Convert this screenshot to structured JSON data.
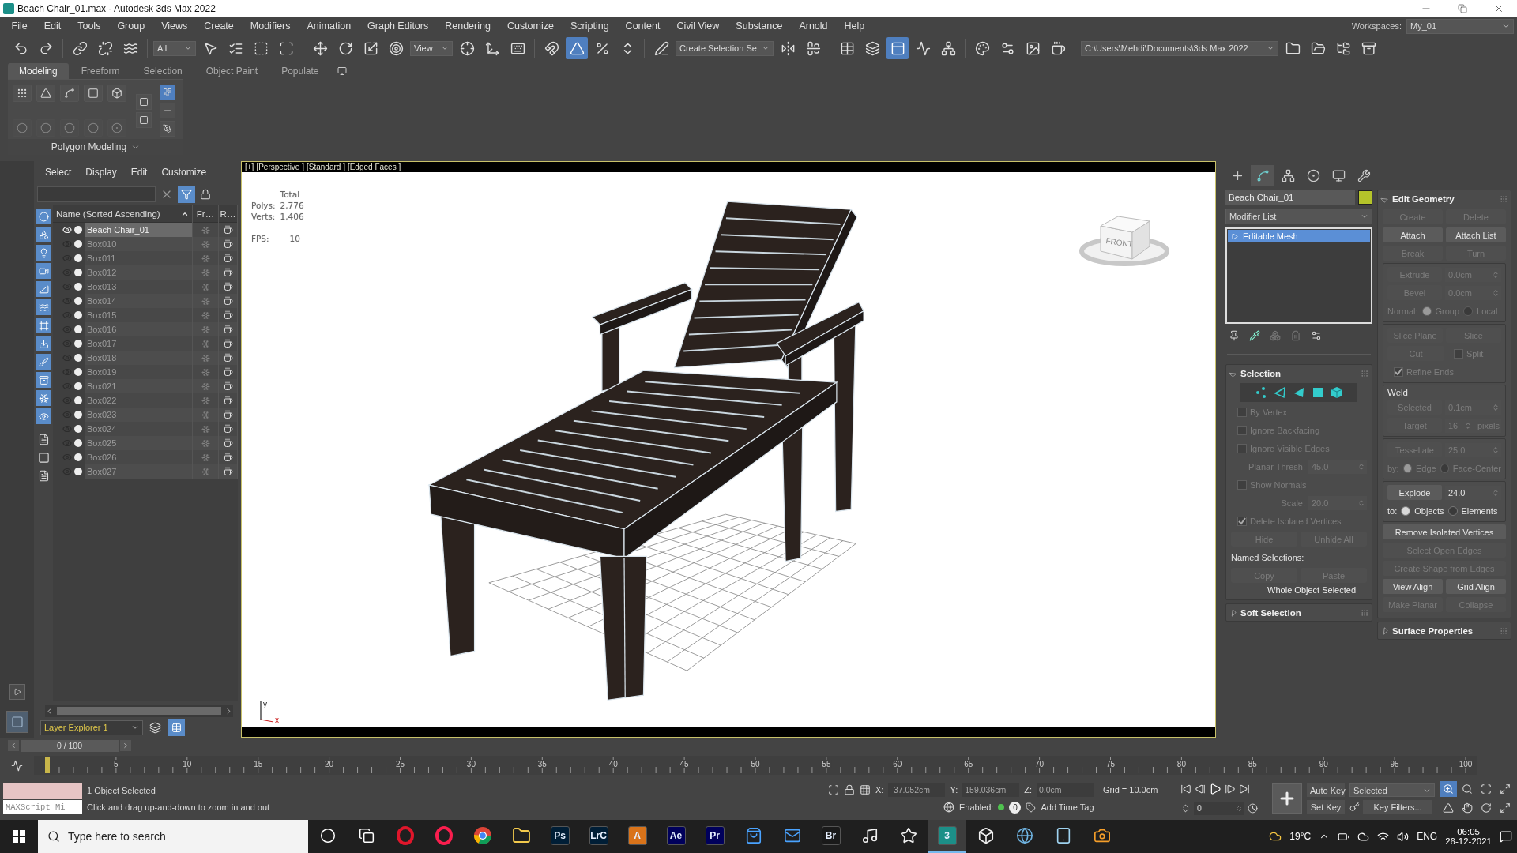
{
  "window": {
    "title": "Beach Chair_01.max - Autodesk 3ds Max 2022"
  },
  "menu": [
    "File",
    "Edit",
    "Tools",
    "Group",
    "Views",
    "Create",
    "Modifiers",
    "Animation",
    "Graph Editors",
    "Rendering",
    "Customize",
    "Scripting",
    "Content",
    "Civil View",
    "Substance",
    "Arnold",
    "Help"
  ],
  "workspace": {
    "label": "Workspaces:",
    "value": "My_01"
  },
  "toolbar": [
    {
      "kind": "button",
      "on": false
    },
    {
      "kind": "button",
      "on": false
    },
    {
      "kind": "separator"
    },
    {
      "kind": "button",
      "on": false
    },
    {
      "kind": "button",
      "on": false
    },
    {
      "kind": "button",
      "on": false
    },
    {
      "kind": "separator"
    },
    {
      "kind": "dropdown",
      "value": "All"
    },
    {
      "kind": "button",
      "on": false
    },
    {
      "kind": "button",
      "on": false
    },
    {
      "kind": "button",
      "on": false
    },
    {
      "kind": "button",
      "on": false
    },
    {
      "kind": "separator"
    },
    {
      "kind": "button",
      "on": false
    },
    {
      "kind": "button",
      "on": false
    },
    {
      "kind": "button",
      "on": false
    },
    {
      "kind": "button",
      "on": false
    },
    {
      "kind": "dropdown",
      "value": "View"
    },
    {
      "kind": "button",
      "on": false
    },
    {
      "kind": "button",
      "on": false
    },
    {
      "kind": "button",
      "on": false
    },
    {
      "kind": "separator"
    },
    {
      "kind": "button",
      "on": false
    },
    {
      "kind": "button",
      "on": true
    },
    {
      "kind": "button",
      "on": false
    },
    {
      "kind": "button",
      "on": false
    },
    {
      "kind": "separator"
    },
    {
      "kind": "button",
      "on": false
    },
    {
      "kind": "dropdown",
      "value": "Create Selection Se"
    },
    {
      "kind": "button",
      "on": false
    },
    {
      "kind": "button",
      "on": false
    },
    {
      "kind": "separator"
    },
    {
      "kind": "button",
      "on": false
    },
    {
      "kind": "button",
      "on": false
    },
    {
      "kind": "button",
      "on": true
    },
    {
      "kind": "button",
      "on": false
    },
    {
      "kind": "button",
      "on": false
    },
    {
      "kind": "separator"
    },
    {
      "kind": "button",
      "on": false
    },
    {
      "kind": "button",
      "on": false
    },
    {
      "kind": "button",
      "on": false
    },
    {
      "kind": "button",
      "on": false
    },
    {
      "kind": "separator"
    },
    {
      "kind": "path",
      "value": "C:\\Users\\Mehdi\\Documents\\3ds Max 2022"
    },
    {
      "kind": "button",
      "on": false
    },
    {
      "kind": "button",
      "on": false
    },
    {
      "kind": "button",
      "on": false
    },
    {
      "kind": "button",
      "on": false
    }
  ],
  "ribbon": {
    "tabs": [
      {
        "label": "Modeling",
        "selected": true
      },
      {
        "label": "Freeform",
        "selected": false
      },
      {
        "label": "Selection",
        "selected": false
      },
      {
        "label": "Object Paint",
        "selected": false
      },
      {
        "label": "Populate",
        "selected": false
      }
    ],
    "tools": [
      {
        "disabled": false
      },
      {
        "disabled": false
      },
      {
        "disabled": false
      },
      {
        "disabled": false
      },
      {
        "disabled": false
      },
      {
        "disabled": true
      },
      {
        "disabled": true
      },
      {
        "disabled": true
      },
      {
        "disabled": true
      },
      {
        "disabled": true
      }
    ],
    "side_tools": [
      {
        "selected": false
      },
      {
        "selected": false
      },
      {
        "selected": true
      },
      {
        "selected": false
      },
      {
        "selected": false
      }
    ],
    "panel_label": "Polygon Modeling"
  },
  "scene_explorer": {
    "menu": [
      "Select",
      "Display",
      "Edit",
      "Customize"
    ],
    "filters": [
      {
        "on": true
      },
      {
        "on": true
      },
      {
        "on": true
      },
      {
        "on": true
      },
      {
        "on": true
      },
      {
        "on": true
      },
      {
        "on": true
      },
      {
        "on": true
      },
      {
        "on": true
      },
      {
        "on": true
      },
      {
        "on": true
      },
      {
        "on": true
      }
    ],
    "columns": [
      "Name (Sorted Ascending)",
      "Fr…",
      "R…"
    ],
    "rows": [
      {
        "name": "Beach Chair_01",
        "selected": true
      },
      {
        "name": "Box010",
        "selected": false
      },
      {
        "name": "Box011",
        "selected": false
      },
      {
        "name": "Box012",
        "selected": false
      },
      {
        "name": "Box013",
        "selected": false
      },
      {
        "name": "Box014",
        "selected": false
      },
      {
        "name": "Box015",
        "selected": false
      },
      {
        "name": "Box016",
        "selected": false
      },
      {
        "name": "Box017",
        "selected": false
      },
      {
        "name": "Box018",
        "selected": false
      },
      {
        "name": "Box019",
        "selected": false
      },
      {
        "name": "Box021",
        "selected": false
      },
      {
        "name": "Box022",
        "selected": false
      },
      {
        "name": "Box023",
        "selected": false
      },
      {
        "name": "Box024",
        "selected": false
      },
      {
        "name": "Box025",
        "selected": false
      },
      {
        "name": "Box026",
        "selected": false
      },
      {
        "name": "Box027",
        "selected": false
      }
    ],
    "layer": "Layer Explorer 1"
  },
  "viewport": {
    "labels": [
      "[+]",
      "[Perspective ]",
      "[Standard ]",
      "[Edged Faces ]"
    ],
    "stats": {
      "header": "Total",
      "rows": [
        {
          "label": "Polys:",
          "value": "2,776"
        },
        {
          "label": "Verts:",
          "value": "1,406"
        }
      ],
      "fps_label": "FPS:",
      "fps": "10"
    },
    "viewcube": "FRONT",
    "axes": [
      "y",
      "x"
    ]
  },
  "command_panel": {
    "tabs": [
      {
        "selected": false
      },
      {
        "selected": true
      },
      {
        "selected": false
      },
      {
        "selected": false
      },
      {
        "selected": false
      },
      {
        "selected": false
      }
    ],
    "object_name": "Beach Chair_01",
    "modifier_list": "Modifier List",
    "stack": [
      {
        "name": "Editable Mesh",
        "selected": true
      }
    ],
    "left_rollouts": [
      {
        "title": "Selection",
        "expanded": true,
        "items": [
          {
            "kind": "subobjects"
          },
          {
            "kind": "checkbox",
            "label": "By Vertex",
            "checked": false,
            "disabled": true
          },
          {
            "kind": "checkbox",
            "label": "Ignore Backfacing",
            "checked": false,
            "disabled": true
          },
          {
            "kind": "checkbox",
            "label": "Ignore Visible Edges",
            "checked": false,
            "disabled": true
          },
          {
            "kind": "spinner",
            "label": "Planar Thresh:",
            "value": "45.0",
            "disabled": true
          },
          {
            "kind": "checkbox",
            "label": "Show Normals",
            "checked": false,
            "disabled": true
          },
          {
            "kind": "spinner",
            "label": "Scale:",
            "value": "20.0",
            "disabled": true
          },
          {
            "kind": "checkbox",
            "label": "Delete Isolated Vertices",
            "checked": true,
            "disabled": true
          },
          {
            "kind": "buttons",
            "buttons": [
              {
                "label": "Hide",
                "disabled": true
              },
              {
                "label": "Unhide All",
                "disabled": true
              }
            ]
          },
          {
            "kind": "label",
            "text": "Named Selections:"
          },
          {
            "kind": "buttons",
            "buttons": [
              {
                "label": "Copy",
                "disabled": true
              },
              {
                "label": "Paste",
                "disabled": true
              }
            ]
          },
          {
            "kind": "note",
            "text": "Whole Object Selected"
          }
        ]
      },
      {
        "title": "Soft Selection",
        "expanded": false
      }
    ],
    "right_rollouts": [
      {
        "title": "Edit Geometry",
        "expanded": true,
        "items": [
          {
            "kind": "buttons",
            "buttons": [
              {
                "label": "Create",
                "disabled": true
              },
              {
                "label": "Delete",
                "disabled": true
              }
            ]
          },
          {
            "kind": "buttons",
            "buttons": [
              {
                "label": "Attach",
                "disabled": false
              },
              {
                "label": "Attach List",
                "disabled": false
              }
            ]
          },
          {
            "kind": "buttons",
            "buttons": [
              {
                "label": "Break",
                "disabled": true
              },
              {
                "label": "Turn",
                "disabled": true
              }
            ]
          },
          {
            "kind": "group",
            "items": [
              {
                "kind": "button_spinner",
                "button": "Extrude",
                "value": "0.0cm",
                "disabled": true
              },
              {
                "kind": "button_spinner",
                "button": "Bevel",
                "value": "0.0cm",
                "disabled": true
              },
              {
                "kind": "radio",
                "label": "Normal:",
                "disabled": true,
                "options": [
                  {
                    "label": "Group",
                    "selected": true
                  },
                  {
                    "label": "Local",
                    "selected": false
                  }
                ]
              }
            ]
          },
          {
            "kind": "group",
            "items": [
              {
                "kind": "buttons",
                "buttons": [
                  {
                    "label": "Slice Plane",
                    "disabled": true
                  },
                  {
                    "label": "Slice",
                    "disabled": true
                  }
                ]
              },
              {
                "kind": "button_checkbox",
                "button": "Cut",
                "label": "Split",
                "checked": false,
                "disabled": true
              },
              {
                "kind": "checkbox",
                "label": "Refine Ends",
                "checked": true,
                "disabled": true
              }
            ]
          },
          {
            "kind": "group",
            "title": "Weld",
            "items": [
              {
                "kind": "button_spinner",
                "button": "Selected",
                "value": "0.1cm",
                "disabled": true
              },
              {
                "kind": "button_spinner",
                "button": "Target",
                "value": "16",
                "suffix": "pixels",
                "disabled": true
              }
            ]
          },
          {
            "kind": "group",
            "items": [
              {
                "kind": "button_spinner",
                "button": "Tessellate",
                "value": "25.0",
                "disabled": true
              },
              {
                "kind": "radio",
                "label": "by:",
                "disabled": true,
                "options": [
                  {
                    "label": "Edge",
                    "selected": true
                  },
                  {
                    "label": "Face-Center",
                    "selected": false
                  }
                ]
              }
            ]
          },
          {
            "kind": "group",
            "items": [
              {
                "kind": "button_spinner",
                "button": "Explode",
                "value": "24.0",
                "disabled": false
              },
              {
                "kind": "radio",
                "label": "to:",
                "disabled": false,
                "options": [
                  {
                    "label": "Objects",
                    "selected": true
                  },
                  {
                    "label": "Elements",
                    "selected": false
                  }
                ]
              }
            ]
          },
          {
            "kind": "buttons",
            "buttons": [
              {
                "label": "Remove Isolated Vertices",
                "disabled": false
              }
            ]
          },
          {
            "kind": "buttons",
            "buttons": [
              {
                "label": "Select Open Edges",
                "disabled": true
              }
            ]
          },
          {
            "kind": "buttons",
            "buttons": [
              {
                "label": "Create Shape from Edges",
                "disabled": true
              }
            ]
          },
          {
            "kind": "buttons",
            "buttons": [
              {
                "label": "View Align",
                "disabled": false
              },
              {
                "label": "Grid Align",
                "disabled": false
              }
            ]
          },
          {
            "kind": "buttons",
            "buttons": [
              {
                "label": "Make Planar",
                "disabled": true
              },
              {
                "label": "Collapse",
                "disabled": true
              }
            ]
          }
        ]
      },
      {
        "title": "Surface Properties",
        "expanded": false
      }
    ]
  },
  "time_slider": "0 / 100",
  "track_labels": [
    "5",
    "10",
    "15",
    "20",
    "25",
    "30",
    "35",
    "40",
    "45",
    "50",
    "55",
    "60",
    "65",
    "70",
    "75",
    "80",
    "85",
    "90",
    "95",
    "100"
  ],
  "status": {
    "maxscript": "MAXScript Mi",
    "selection": "1 Object Selected",
    "prompt": "Click and drag up-and-down to zoom in and out",
    "coords": [
      {
        "label": "X:",
        "value": "-37.052cm"
      },
      {
        "label": "Y:",
        "value": "159.036cm"
      },
      {
        "label": "Z:",
        "value": "0.0cm"
      }
    ],
    "grid": "Grid = 10.0cm",
    "enabled_label": "Enabled:",
    "tag_count": "0",
    "add_time_tag": "Add Time Tag",
    "frame": "0",
    "auto_key": "Auto Key",
    "set_key": "Set Key",
    "key_mode": "Selected",
    "key_filters": "Key Filters..."
  },
  "taskbar": {
    "search": {
      "placeholder": "Type here to search"
    },
    "apps": [
      {
        "kind": "ring",
        "active": false
      },
      {
        "kind": "taskview",
        "active": false
      },
      {
        "kind": "o",
        "color": "#e0162b",
        "active": false
      },
      {
        "kind": "o",
        "color": "#fa1e4e",
        "active": false
      },
      {
        "kind": "chrome",
        "active": false
      },
      {
        "kind": "folder",
        "active": false
      },
      {
        "kind": "tile",
        "label": "Ps",
        "color": "#001e36",
        "active": false
      },
      {
        "kind": "tile",
        "label": "LrC",
        "color": "#001e36",
        "active": false
      },
      {
        "kind": "tile",
        "label": "A",
        "color": "#d9731a",
        "active": false
      },
      {
        "kind": "tile",
        "label": "Ae",
        "color": "#00005b",
        "active": false
      },
      {
        "kind": "tile",
        "label": "Pr",
        "color": "#00005b",
        "active": false
      },
      {
        "kind": "bag",
        "active": false
      },
      {
        "kind": "mail",
        "active": false
      },
      {
        "kind": "tile",
        "label": "Br",
        "color": "#1a1a1a",
        "active": false
      },
      {
        "kind": "music",
        "active": false
      },
      {
        "kind": "star",
        "active": false
      },
      {
        "kind": "tile",
        "label": "3",
        "color": "#1c8f88",
        "active": true
      },
      {
        "kind": "cube",
        "active": false
      },
      {
        "kind": "globe",
        "active": false
      },
      {
        "kind": "tablet",
        "active": false
      },
      {
        "kind": "camera",
        "active": false
      }
    ],
    "temperature": "19°C",
    "language": "ENG",
    "time": "06:05",
    "date": "26-12-2021"
  }
}
